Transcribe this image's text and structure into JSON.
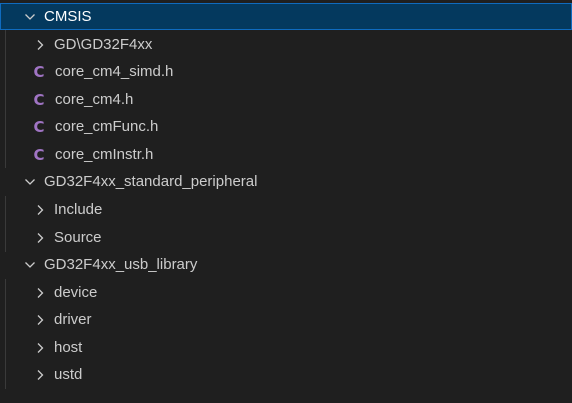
{
  "tree": {
    "root": {
      "label": "CMSIS",
      "expanded": true,
      "children": [
        {
          "label": "GD\\GD32F4xx",
          "kind": "folder"
        },
        {
          "label": "core_cm4_simd.h",
          "kind": "c-file",
          "icon_glyph": "C"
        },
        {
          "label": "core_cm4.h",
          "kind": "c-file",
          "icon_glyph": "C"
        },
        {
          "label": "core_cmFunc.h",
          "kind": "c-file",
          "icon_glyph": "C"
        },
        {
          "label": "core_cmInstr.h",
          "kind": "c-file",
          "icon_glyph": "C"
        }
      ]
    },
    "std_periph": {
      "label": "GD32F4xx_standard_peripheral",
      "expanded": true,
      "children": [
        {
          "label": "Include",
          "kind": "folder"
        },
        {
          "label": "Source",
          "kind": "folder"
        }
      ]
    },
    "usb_lib": {
      "label": "GD32F4xx_usb_library",
      "expanded": true,
      "children": [
        {
          "label": "device",
          "kind": "folder"
        },
        {
          "label": "driver",
          "kind": "folder"
        },
        {
          "label": "host",
          "kind": "folder"
        },
        {
          "label": "ustd",
          "kind": "folder"
        }
      ]
    }
  },
  "colors": {
    "background": "#1f1f1f",
    "selected_background": "#04395e",
    "selected_border": "#0f6bbf",
    "text": "#cccccc",
    "c_file_icon": "#a074c4"
  },
  "icons": {
    "expanded": "chevron-down-icon",
    "collapsed": "chevron-right-icon",
    "c_file": "c-language-file-icon"
  }
}
